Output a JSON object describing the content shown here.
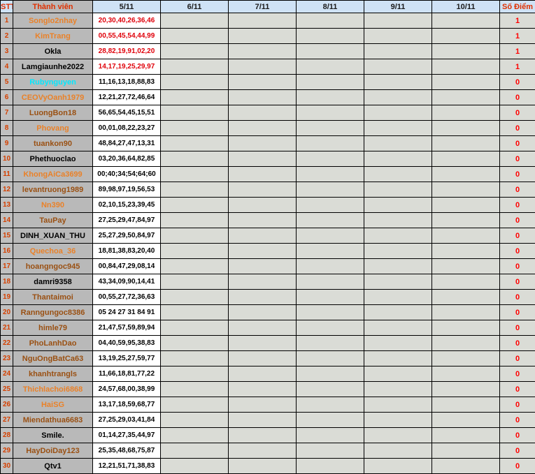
{
  "table": {
    "headers": {
      "stt": "STT",
      "member": "Thành viên",
      "dates": [
        "5/11",
        "6/11",
        "7/11",
        "8/11",
        "9/11",
        "10/11"
      ],
      "score": "Số Điểm"
    },
    "colors": {
      "orange": "#ea8128",
      "brown": "#9a5012",
      "black": "#000000",
      "cyan": "#00e8ff",
      "red": "#e0000a"
    },
    "rows": [
      {
        "stt": "1",
        "name": "Songlo2nhay",
        "color": "orange",
        "numbers": "20,30,40,26,36,46",
        "red": true,
        "score": "1"
      },
      {
        "stt": "2",
        "name": "KimTrang",
        "color": "orange",
        "numbers": "00,55,45,54,44,99",
        "red": true,
        "score": "1"
      },
      {
        "stt": "3",
        "name": "Okla",
        "color": "black",
        "numbers": "28,82,19,91,02,20",
        "red": true,
        "score": "1"
      },
      {
        "stt": "4",
        "name": "Lamgiaunhe2022",
        "color": "black",
        "numbers": "14,17,19,25,29,97",
        "red": true,
        "score": "1"
      },
      {
        "stt": "5",
        "name": "Rubynguyen",
        "color": "cyan",
        "numbers": "11,16,13,18,88,83",
        "red": false,
        "score": "0"
      },
      {
        "stt": "6",
        "name": "CEOVyOanh1979",
        "color": "orange",
        "numbers": "12,21,27,72,46,64",
        "red": false,
        "score": "0"
      },
      {
        "stt": "7",
        "name": "LuongBon18",
        "color": "brown",
        "numbers": "56,65,54,45,15,51",
        "red": false,
        "score": "0"
      },
      {
        "stt": "8",
        "name": "Phovang",
        "color": "orange",
        "numbers": "00,01,08,22,23,27",
        "red": false,
        "score": "0"
      },
      {
        "stt": "9",
        "name": "tuankon90",
        "color": "brown",
        "numbers": "48,84,27,47,13,31",
        "red": false,
        "score": "0"
      },
      {
        "stt": "10",
        "name": "Phethuoclao",
        "color": "black",
        "numbers": "03,20,36,64,82,85",
        "red": false,
        "score": "0"
      },
      {
        "stt": "11",
        "name": "KhongAiCa3699",
        "color": "orange",
        "numbers": "00;40;34;54;64;60",
        "red": false,
        "score": "0"
      },
      {
        "stt": "12",
        "name": "levantruong1989",
        "color": "brown",
        "numbers": "89,98,97,19,56,53",
        "red": false,
        "score": "0"
      },
      {
        "stt": "13",
        "name": "Nn390",
        "color": "orange",
        "numbers": "02,10,15,23,39,45",
        "red": false,
        "score": "0"
      },
      {
        "stt": "14",
        "name": "TauPay",
        "color": "brown",
        "numbers": "27,25,29,47,84,97",
        "red": false,
        "score": "0"
      },
      {
        "stt": "15",
        "name": "DINH_XUAN_THU",
        "color": "black",
        "numbers": "25,27,29,50,84,97",
        "red": false,
        "score": "0"
      },
      {
        "stt": "16",
        "name": "Quechoa_36",
        "color": "orange",
        "numbers": "18,81,38,83,20,40",
        "red": false,
        "score": "0"
      },
      {
        "stt": "17",
        "name": "hoangngoc945",
        "color": "brown",
        "numbers": "00,84,47,29,08,14",
        "red": false,
        "score": "0"
      },
      {
        "stt": "18",
        "name": "damri9358",
        "color": "black",
        "numbers": "43,34,09,90,14,41",
        "red": false,
        "score": "0"
      },
      {
        "stt": "19",
        "name": "Thantaimoi",
        "color": "brown",
        "numbers": "00,55,27,72,36,63",
        "red": false,
        "score": "0"
      },
      {
        "stt": "20",
        "name": "Ranngungoc8386",
        "color": "brown",
        "numbers": "05 24 27 31 84 91",
        "red": false,
        "score": "0"
      },
      {
        "stt": "21",
        "name": "himle79",
        "color": "brown",
        "numbers": "21,47,57,59,89,94",
        "red": false,
        "score": "0"
      },
      {
        "stt": "22",
        "name": "PhoLanhDao",
        "color": "brown",
        "numbers": "04,40,59,95,38,83",
        "red": false,
        "score": "0"
      },
      {
        "stt": "23",
        "name": "NguOngBatCa63",
        "color": "brown",
        "numbers": "13,19,25,27,59,77",
        "red": false,
        "score": "0"
      },
      {
        "stt": "24",
        "name": "khanhtrangls",
        "color": "brown",
        "numbers": "11,66,18,81,77,22",
        "red": false,
        "score": "0"
      },
      {
        "stt": "25",
        "name": "Thichlachoi6868",
        "color": "orange",
        "numbers": "24,57,68,00,38,99",
        "red": false,
        "score": "0"
      },
      {
        "stt": "26",
        "name": "HaiSG",
        "color": "orange",
        "numbers": "13,17,18,59,68,77",
        "red": false,
        "score": "0"
      },
      {
        "stt": "27",
        "name": "Miendathua6683",
        "color": "brown",
        "numbers": "27,25,29,03,41,84",
        "red": false,
        "score": "0"
      },
      {
        "stt": "28",
        "name": "Smile.",
        "color": "black",
        "numbers": "01,14,27,35,44,97",
        "red": false,
        "score": "0"
      },
      {
        "stt": "29",
        "name": "HayDoiDay123",
        "color": "brown",
        "numbers": "25,35,48,68,75,87",
        "red": false,
        "score": "0"
      },
      {
        "stt": "30",
        "name": "Qtv1",
        "color": "black",
        "numbers": "12,21,51,71,38,83",
        "red": false,
        "score": "0"
      }
    ]
  }
}
